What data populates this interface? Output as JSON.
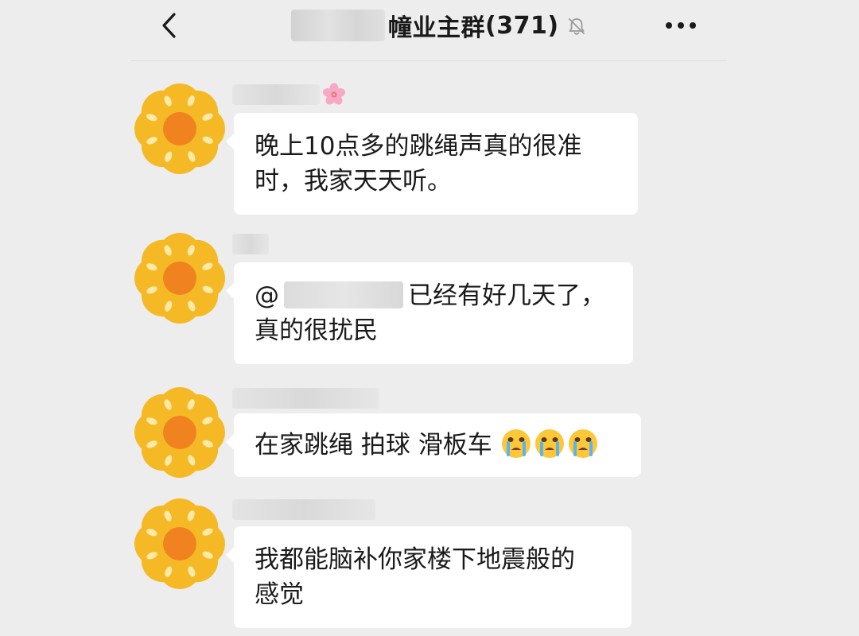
{
  "header": {
    "title": "幢业主群",
    "member_count": "(371)",
    "back_icon": "chevron-left-icon",
    "mute_icon": "bell-off-icon",
    "more_icon": "more-dots-icon"
  },
  "messages": [
    {
      "sender_emoji": "cherry-blossom-icon",
      "line1": "晚上10点多的跳绳声真的很准",
      "line2": "时，我家天天听。"
    },
    {
      "mention_prefix": "@",
      "line1_after_mention": "已经有好几天了，",
      "line2": "真的很扰民"
    },
    {
      "text": "在家跳绳 拍球 滑板车",
      "emojis": [
        "crying-face-icon",
        "crying-face-icon",
        "crying-face-icon"
      ]
    },
    {
      "line1": "我都能脑补你家楼下地震般的",
      "line2": "感觉"
    }
  ],
  "colors": {
    "background": "#ededed",
    "bubble": "#ffffff",
    "avatar_flower": "#f6b926",
    "avatar_center": "#f08220"
  }
}
